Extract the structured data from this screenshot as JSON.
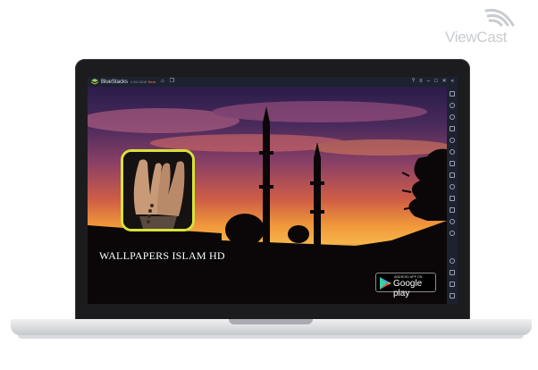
{
  "watermark": {
    "text": "ViewCast",
    "icon": "wifi-signal-icon"
  },
  "window": {
    "app_name": "BlueStacks",
    "version": "4.60.1508",
    "beta": "Beta",
    "title_icons": [
      "home-icon",
      "multi-instance-icon"
    ],
    "controls": [
      "help-icon",
      "menu-icon",
      "minimize-icon",
      "maximize-icon",
      "close-icon",
      "collapse-sidebar-icon"
    ]
  },
  "app": {
    "title": "WALLPAPERS ISLAM HD",
    "icon": "praying-hands-icon",
    "icon_border_color": "#d8e23a"
  },
  "badge": {
    "small_text": "ANDROID APP ON",
    "big_text": "Google play",
    "icon": "google-play-triangle-icon"
  },
  "sidebar": {
    "icons": [
      "fullscreen-icon",
      "volume-up-icon",
      "volume-down-icon",
      "keyboard-icon",
      "eye-icon",
      "rotate-icon",
      "shake-icon",
      "screenshot-icon",
      "record-icon",
      "folder-icon",
      "copy-icon",
      "macro-icon",
      "location-icon",
      "settings-icon",
      "back-icon",
      "home-nav-icon",
      "recents-icon"
    ]
  },
  "colors": {
    "sky_top": "#2a1d4a",
    "sky_mid": "#cf5d46",
    "sky_horizon": "#f7b44a",
    "chrome": "#1d2130"
  }
}
